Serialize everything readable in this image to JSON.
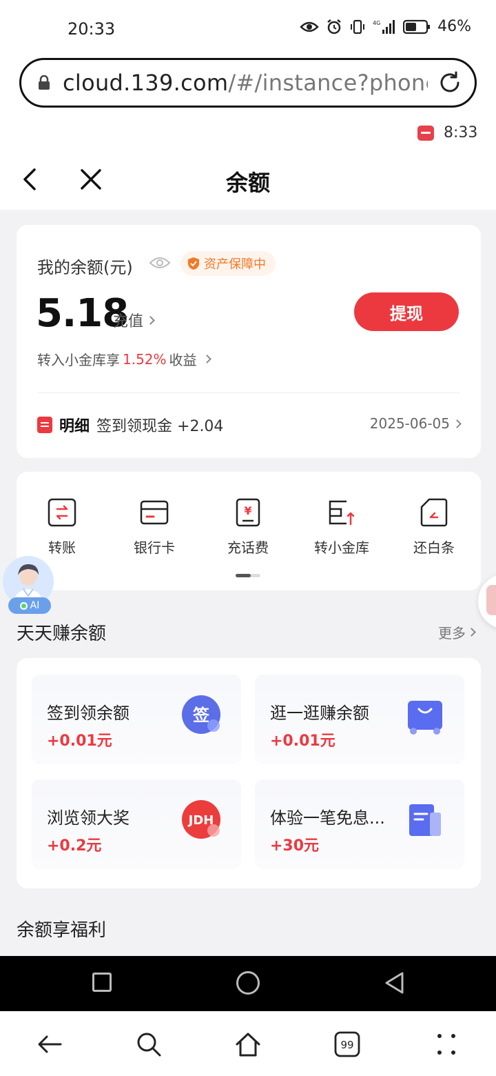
{
  "status_bar": {
    "time": "20:33",
    "battery": "46%"
  },
  "browser": {
    "url_host": "cloud.139.com",
    "url_rest": "/#/instance?phone"
  },
  "mini_status": {
    "time": "8:33"
  },
  "header": {
    "title": "余额"
  },
  "balance": {
    "label": "我的余额(元)",
    "guard_text": "资产保障中",
    "amount": "5.18",
    "recharge": "充值",
    "withdraw": "提现",
    "vault_prefix": "转入小金库享",
    "vault_rate": "1.52%",
    "vault_suffix": "收益",
    "detail_label": "明细",
    "detail_text": "签到领现金 +2.04",
    "detail_date": "2025-06-05"
  },
  "shortcuts": [
    {
      "label": "转账",
      "icon": "transfer-icon"
    },
    {
      "label": "银行卡",
      "icon": "bank-card-icon"
    },
    {
      "label": "充话费",
      "icon": "phone-bill-icon"
    },
    {
      "label": "转小金库",
      "icon": "vault-icon"
    },
    {
      "label": "还白条",
      "icon": "repay-icon"
    }
  ],
  "ai_badge": "AI",
  "earn": {
    "title": "天天赚余额",
    "more": "更多",
    "tasks": [
      {
        "name": "签到领余额",
        "value": "+0.01元",
        "icon": "sign-in-icon",
        "icon_text": "签"
      },
      {
        "name": "逛一逛赚余额",
        "value": "+0.01元",
        "icon": "shopping-bag-icon"
      },
      {
        "name": "浏览领大奖",
        "value": "+0.2元",
        "icon": "jdh-icon",
        "icon_text": "JDH"
      },
      {
        "name": "体验一笔免息...",
        "value": "+30元",
        "icon": "document-icon"
      }
    ]
  },
  "benefits": {
    "title": "余额享福利"
  },
  "colors": {
    "accent": "#ec3940",
    "guard": "#f07a2a",
    "sign_icon": "#5b6ee8",
    "bag_icon": "#5a6cf0"
  }
}
